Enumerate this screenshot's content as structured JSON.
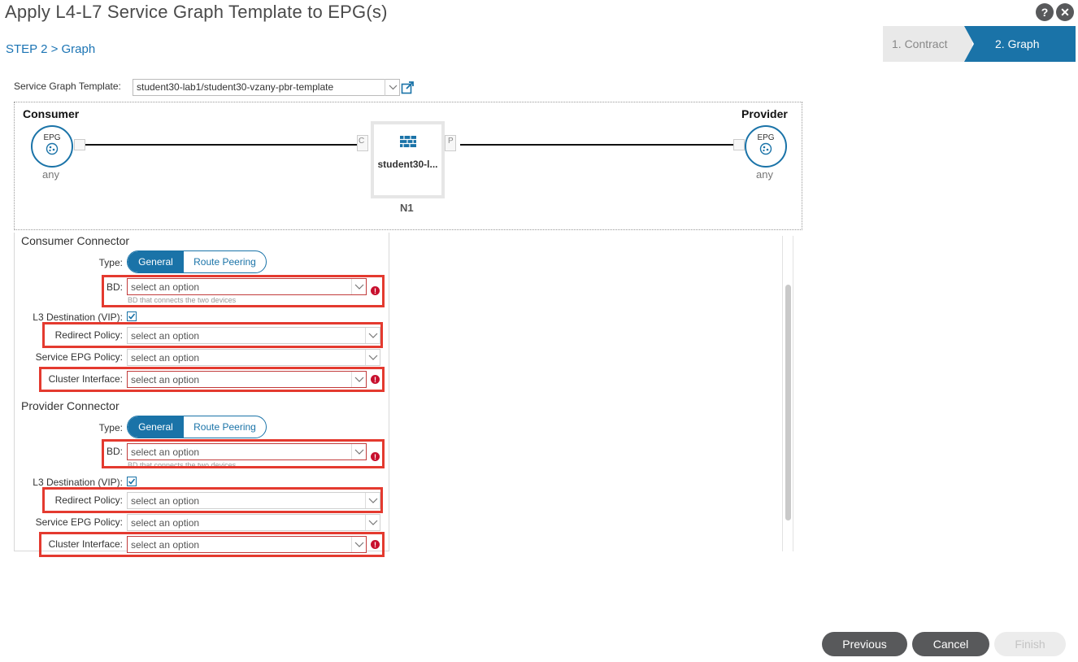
{
  "header": {
    "title": "Apply L4-L7 Service Graph Template to EPG(s)",
    "step_label": "STEP 2 > Graph",
    "help_icon": "?",
    "close_icon": "✕"
  },
  "wizard": {
    "steps": [
      {
        "label": "1. Contract"
      },
      {
        "label": "2. Graph"
      }
    ]
  },
  "template": {
    "label": "Service Graph Template:",
    "value": "student30-lab1/student30-vzany-pbr-template"
  },
  "graph": {
    "consumer": {
      "heading": "Consumer",
      "epg_label": "EPG",
      "name": "any"
    },
    "provider": {
      "heading": "Provider",
      "epg_label": "EPG",
      "name": "any"
    },
    "node": {
      "label": "student30-l...",
      "id": "N1",
      "port_consumer": "C",
      "port_provider": "P"
    }
  },
  "consumer_connector": {
    "title": "Consumer Connector",
    "type_label": "Type:",
    "type_options": [
      "General",
      "Route Peering"
    ],
    "bd_label": "BD:",
    "bd_placeholder": "select an option",
    "bd_hint": "BD that connects the two devices",
    "l3_label": "L3 Destination (VIP):",
    "redirect_label": "Redirect Policy:",
    "redirect_placeholder": "select an option",
    "service_epg_label": "Service EPG Policy:",
    "service_epg_placeholder": "select an option",
    "cluster_label": "Cluster Interface:",
    "cluster_placeholder": "select an option"
  },
  "provider_connector": {
    "title": "Provider Connector",
    "type_label": "Type:",
    "type_options": [
      "General",
      "Route Peering"
    ],
    "bd_label": "BD:",
    "bd_placeholder": "select an option",
    "bd_hint": "BD that connects the two devices",
    "l3_label": "L3 Destination (VIP):",
    "redirect_label": "Redirect Policy:",
    "redirect_placeholder": "select an option",
    "service_epg_label": "Service EPG Policy:",
    "service_epg_placeholder": "select an option",
    "cluster_label": "Cluster Interface:",
    "cluster_placeholder": "select an option"
  },
  "error_icon": "!",
  "footer": {
    "previous": "Previous",
    "cancel": "Cancel",
    "finish": "Finish"
  },
  "colors": {
    "accent": "#1a73a8",
    "error": "#c8102e",
    "highlight": "#e43a2f"
  }
}
